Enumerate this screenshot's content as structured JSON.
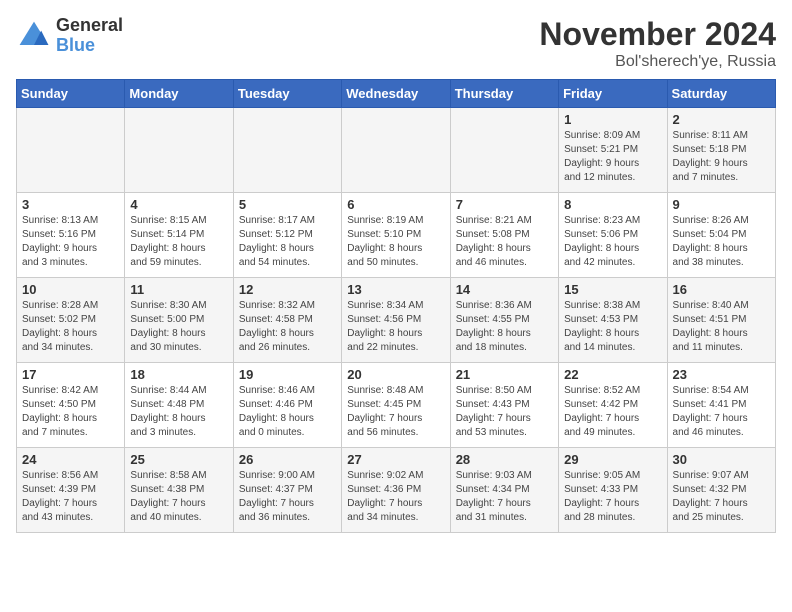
{
  "logo": {
    "general": "General",
    "blue": "Blue"
  },
  "title": {
    "month": "November 2024",
    "location": "Bol'sherech'ye, Russia"
  },
  "header_days": [
    "Sunday",
    "Monday",
    "Tuesday",
    "Wednesday",
    "Thursday",
    "Friday",
    "Saturday"
  ],
  "weeks": [
    [
      {
        "day": "",
        "info": ""
      },
      {
        "day": "",
        "info": ""
      },
      {
        "day": "",
        "info": ""
      },
      {
        "day": "",
        "info": ""
      },
      {
        "day": "",
        "info": ""
      },
      {
        "day": "1",
        "info": "Sunrise: 8:09 AM\nSunset: 5:21 PM\nDaylight: 9 hours\nand 12 minutes."
      },
      {
        "day": "2",
        "info": "Sunrise: 8:11 AM\nSunset: 5:18 PM\nDaylight: 9 hours\nand 7 minutes."
      }
    ],
    [
      {
        "day": "3",
        "info": "Sunrise: 8:13 AM\nSunset: 5:16 PM\nDaylight: 9 hours\nand 3 minutes."
      },
      {
        "day": "4",
        "info": "Sunrise: 8:15 AM\nSunset: 5:14 PM\nDaylight: 8 hours\nand 59 minutes."
      },
      {
        "day": "5",
        "info": "Sunrise: 8:17 AM\nSunset: 5:12 PM\nDaylight: 8 hours\nand 54 minutes."
      },
      {
        "day": "6",
        "info": "Sunrise: 8:19 AM\nSunset: 5:10 PM\nDaylight: 8 hours\nand 50 minutes."
      },
      {
        "day": "7",
        "info": "Sunrise: 8:21 AM\nSunset: 5:08 PM\nDaylight: 8 hours\nand 46 minutes."
      },
      {
        "day": "8",
        "info": "Sunrise: 8:23 AM\nSunset: 5:06 PM\nDaylight: 8 hours\nand 42 minutes."
      },
      {
        "day": "9",
        "info": "Sunrise: 8:26 AM\nSunset: 5:04 PM\nDaylight: 8 hours\nand 38 minutes."
      }
    ],
    [
      {
        "day": "10",
        "info": "Sunrise: 8:28 AM\nSunset: 5:02 PM\nDaylight: 8 hours\nand 34 minutes."
      },
      {
        "day": "11",
        "info": "Sunrise: 8:30 AM\nSunset: 5:00 PM\nDaylight: 8 hours\nand 30 minutes."
      },
      {
        "day": "12",
        "info": "Sunrise: 8:32 AM\nSunset: 4:58 PM\nDaylight: 8 hours\nand 26 minutes."
      },
      {
        "day": "13",
        "info": "Sunrise: 8:34 AM\nSunset: 4:56 PM\nDaylight: 8 hours\nand 22 minutes."
      },
      {
        "day": "14",
        "info": "Sunrise: 8:36 AM\nSunset: 4:55 PM\nDaylight: 8 hours\nand 18 minutes."
      },
      {
        "day": "15",
        "info": "Sunrise: 8:38 AM\nSunset: 4:53 PM\nDaylight: 8 hours\nand 14 minutes."
      },
      {
        "day": "16",
        "info": "Sunrise: 8:40 AM\nSunset: 4:51 PM\nDaylight: 8 hours\nand 11 minutes."
      }
    ],
    [
      {
        "day": "17",
        "info": "Sunrise: 8:42 AM\nSunset: 4:50 PM\nDaylight: 8 hours\nand 7 minutes."
      },
      {
        "day": "18",
        "info": "Sunrise: 8:44 AM\nSunset: 4:48 PM\nDaylight: 8 hours\nand 3 minutes."
      },
      {
        "day": "19",
        "info": "Sunrise: 8:46 AM\nSunset: 4:46 PM\nDaylight: 8 hours\nand 0 minutes."
      },
      {
        "day": "20",
        "info": "Sunrise: 8:48 AM\nSunset: 4:45 PM\nDaylight: 7 hours\nand 56 minutes."
      },
      {
        "day": "21",
        "info": "Sunrise: 8:50 AM\nSunset: 4:43 PM\nDaylight: 7 hours\nand 53 minutes."
      },
      {
        "day": "22",
        "info": "Sunrise: 8:52 AM\nSunset: 4:42 PM\nDaylight: 7 hours\nand 49 minutes."
      },
      {
        "day": "23",
        "info": "Sunrise: 8:54 AM\nSunset: 4:41 PM\nDaylight: 7 hours\nand 46 minutes."
      }
    ],
    [
      {
        "day": "24",
        "info": "Sunrise: 8:56 AM\nSunset: 4:39 PM\nDaylight: 7 hours\nand 43 minutes."
      },
      {
        "day": "25",
        "info": "Sunrise: 8:58 AM\nSunset: 4:38 PM\nDaylight: 7 hours\nand 40 minutes."
      },
      {
        "day": "26",
        "info": "Sunrise: 9:00 AM\nSunset: 4:37 PM\nDaylight: 7 hours\nand 36 minutes."
      },
      {
        "day": "27",
        "info": "Sunrise: 9:02 AM\nSunset: 4:36 PM\nDaylight: 7 hours\nand 34 minutes."
      },
      {
        "day": "28",
        "info": "Sunrise: 9:03 AM\nSunset: 4:34 PM\nDaylight: 7 hours\nand 31 minutes."
      },
      {
        "day": "29",
        "info": "Sunrise: 9:05 AM\nSunset: 4:33 PM\nDaylight: 7 hours\nand 28 minutes."
      },
      {
        "day": "30",
        "info": "Sunrise: 9:07 AM\nSunset: 4:32 PM\nDaylight: 7 hours\nand 25 minutes."
      }
    ]
  ]
}
